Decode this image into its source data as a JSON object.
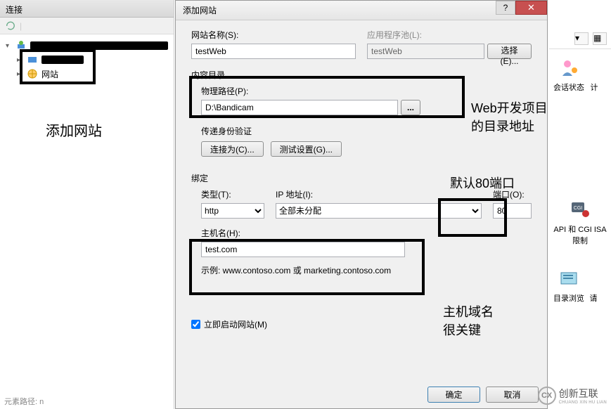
{
  "left_panel": {
    "title": "连接",
    "tree": {
      "site_node": "网站"
    }
  },
  "dialog": {
    "title": "添加网站",
    "site_name_label": "网站名称(S):",
    "site_name_value": "testWeb",
    "app_pool_label": "应用程序池(L):",
    "app_pool_value": "testWeb",
    "select_btn": "选择(E)...",
    "content_dir_title": "内容目录",
    "phys_path_label": "物理路径(P):",
    "phys_path_value": "D:\\Bandicam",
    "browse_btn": "...",
    "passthrough_title": "传递身份验证",
    "connect_as_btn": "连接为(C)...",
    "test_settings_btn": "测试设置(G)...",
    "binding_title": "绑定",
    "type_label": "类型(T):",
    "type_value": "http",
    "ip_label": "IP 地址(I):",
    "ip_value": "全部未分配",
    "port_label": "端口(O):",
    "port_value": "80",
    "host_label": "主机名(H):",
    "host_value": "test.com",
    "example_text": "示例: www.contoso.com 或 marketing.contoso.com",
    "start_site_label": "立即启动网站(M)",
    "ok_btn": "确定",
    "cancel_btn": "取消"
  },
  "annotations": {
    "add_site": "添加网站",
    "web_dev_line1": "Web开发项目",
    "web_dev_line2": "的目录地址",
    "default_port": "默认80端口",
    "host_key_line1": "主机域名",
    "host_key_line2": "很关键"
  },
  "right": {
    "item1": "会话状态",
    "item1b": "计",
    "item2": "API 和 CGI ISA",
    "item2b": "限制",
    "item3": "目录浏览",
    "item3b": "请"
  },
  "logo": {
    "mark": "CX",
    "text1": "创新互联",
    "text2": "CHUANG XIN HU LIAN"
  },
  "status": "元素路径: n"
}
